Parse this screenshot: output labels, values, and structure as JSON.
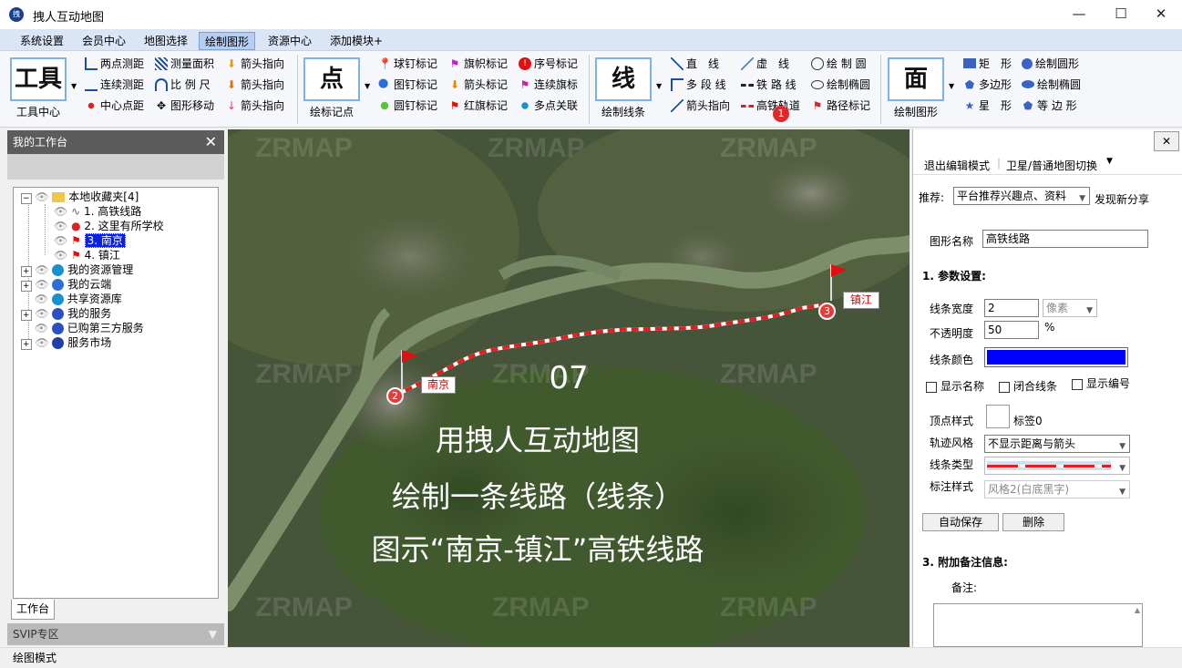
{
  "window": {
    "title": "拽人互动地图",
    "app_icon": "app-logo-icon",
    "min": "—",
    "max": "☐",
    "close": "✕"
  },
  "menu": [
    "系统设置",
    "会员中心",
    "地图选择",
    "绘制图形",
    "资源中心",
    "添加模块+"
  ],
  "menu_active_index": 3,
  "ribbon": {
    "tools": {
      "big": "工具",
      "label": "工具中心",
      "items": [
        "两点测距",
        "连续测距",
        "中心点距",
        "测量面积",
        "比 例 尺",
        "图形移动",
        "箭头指向",
        "箭头指向",
        "箭头指向"
      ]
    },
    "point": {
      "big": "点",
      "label": "绘标记点",
      "items": [
        "球钉标记",
        "图钉标记",
        "圆钉标记",
        "旗帜标记",
        "箭头标记",
        "红旗标记",
        "序号标记",
        "连续旗标",
        "多点关联"
      ]
    },
    "line": {
      "big": "线",
      "label": "绘制线条",
      "items": [
        "直　线",
        "多 段 线",
        "箭头指向",
        "虚　线",
        "铁 路 线",
        "高铁轨道",
        "绘 制 圆",
        "绘制椭圆",
        "路径标记"
      ],
      "badge": "1"
    },
    "area": {
      "big": "面",
      "label": "绘制图形",
      "items": [
        "矩　形",
        "多边形",
        "星　形",
        "绘制圆形",
        "绘制椭圆",
        "等 边 形"
      ]
    }
  },
  "workspace": {
    "title": "我的工作台",
    "tree": [
      {
        "label": "本地收藏夹[4]",
        "icon": "folder-icon"
      },
      {
        "label": "1. 高铁线路",
        "icon": "line-icon"
      },
      {
        "label": "2. 这里有所学校",
        "icon": "pin-icon"
      },
      {
        "label": "3. 南京",
        "icon": "flag-icon",
        "selected": true
      },
      {
        "label": "4. 镇江",
        "icon": "flag-icon"
      },
      {
        "label": "我的资源管理",
        "icon": "globe-icon"
      },
      {
        "label": "我的云端",
        "icon": "cloud-icon"
      },
      {
        "label": "共享资源库",
        "icon": "globe-icon"
      },
      {
        "label": "我的服务",
        "icon": "service-icon"
      },
      {
        "label": "已购第三方服务",
        "icon": "cart-icon"
      },
      {
        "label": "服务市场",
        "icon": "market-icon"
      }
    ],
    "tab": "工作台",
    "svip": "SVIP专区"
  },
  "status": "绘图模式",
  "map": {
    "watermark": "ZRMAP",
    "markers": [
      {
        "num": "2",
        "label": "南京"
      },
      {
        "num": "3",
        "label": "镇江"
      }
    ],
    "overlay": [
      "07",
      "用拽人互动地图",
      "绘制一条线路（线条）",
      "图示“南京-镇江”高铁线路"
    ],
    "route_color": "#e02020"
  },
  "props": {
    "close": "✕",
    "toolbar": [
      "退出编辑模式",
      "卫星/普通地图切换"
    ],
    "recommend_label": "推荐:",
    "recommend_value": "平台推荐兴趣点、资料",
    "discover": "发现新分享",
    "name_label": "图形名称",
    "name_value": "高铁线路",
    "section1": "1. 参数设置:",
    "width_label": "线条宽度",
    "width_value": "2",
    "width_unit": "像素",
    "opacity_label": "不透明度",
    "opacity_value": "50",
    "opacity_unit": "%",
    "color_label": "线条颜色",
    "line_color": "#0000ff",
    "chk_name": "显示名称",
    "chk_close": "闭合线条",
    "chk_num": "显示编号",
    "vertex_label": "顶点样式",
    "vertex_tag": "标签0",
    "track_label": "轨迹风格",
    "track_value": "不显示距离与箭头",
    "type_label": "线条类型",
    "mark_label": "标注样式",
    "mark_value": "风格2(白底黑字)",
    "btn_save": "自动保存",
    "btn_delete": "删除",
    "section3": "3. 附加备注信息:",
    "note_label": "备注:"
  }
}
